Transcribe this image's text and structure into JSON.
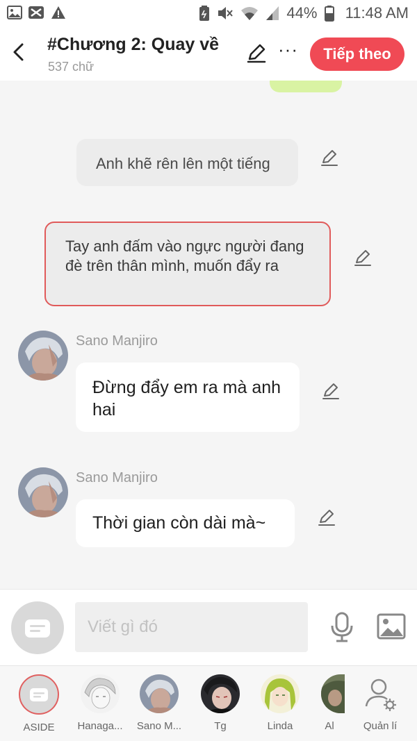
{
  "status_bar": {
    "battery": "44%",
    "time": "11:48 AM",
    "icons": [
      "gallery-icon",
      "capcut-icon",
      "warning-icon",
      "battery-saver-icon",
      "mute-icon",
      "wifi-icon",
      "signal-icon",
      "battery-icon"
    ]
  },
  "header": {
    "title": "#Chương 2: Quay về",
    "subtitle": "537 chữ",
    "next_label": "Tiếp theo",
    "more_label": "···",
    "accent": "#f04a55"
  },
  "chat": {
    "narrations": [
      {
        "text": "Anh khẽ rên lên một tiếng"
      },
      {
        "text": "Tay anh đấm vào ngực người đang đè trên thân mình, muốn đẩy ra"
      }
    ],
    "messages": [
      {
        "sender": "Sano Manjiro",
        "text": "Đừng đẩy em ra mà anh hai"
      },
      {
        "sender": "Sano Manjiro",
        "text": "Thời gian còn dài mà~"
      }
    ]
  },
  "composer": {
    "placeholder": "Viết gì đó"
  },
  "characters": [
    {
      "label": "ASIDE"
    },
    {
      "label": "Hanaga..."
    },
    {
      "label": "Sano M..."
    },
    {
      "label": "Tg"
    },
    {
      "label": "Linda"
    },
    {
      "label": "Al"
    },
    {
      "label": "Quản lí"
    }
  ]
}
